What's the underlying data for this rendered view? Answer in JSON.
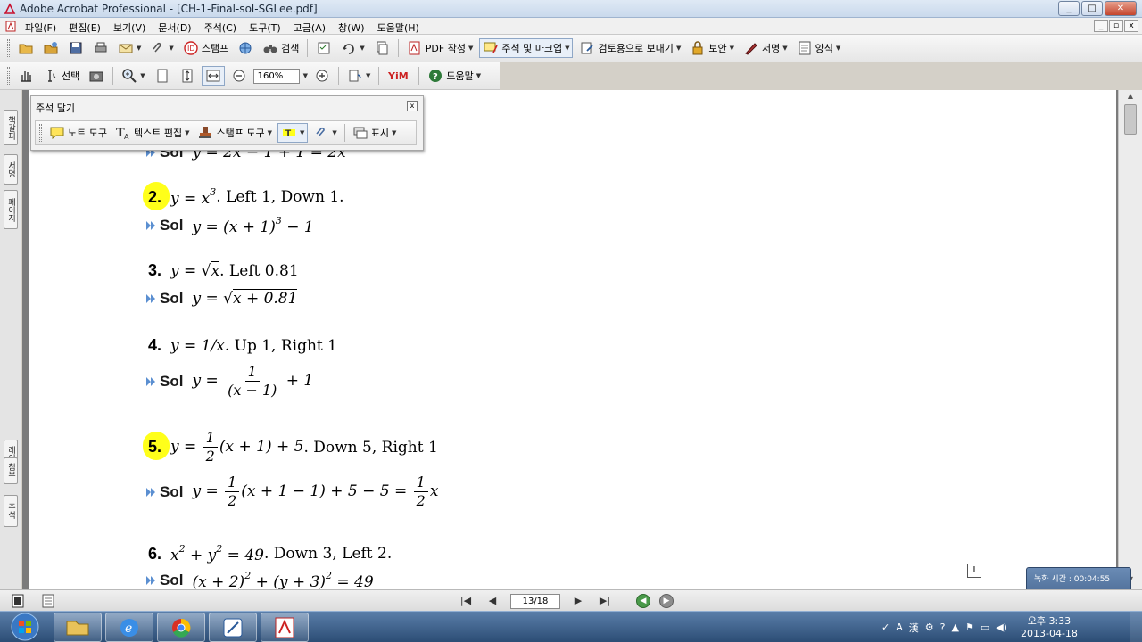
{
  "window": {
    "title": "Adobe Acrobat Professional - [CH-1-Final-sol-SGLee.pdf]",
    "buttons": [
      "_",
      "□",
      "✕"
    ]
  },
  "menu": {
    "items": [
      "파일(F)",
      "편집(E)",
      "보기(V)",
      "문서(D)",
      "주석(C)",
      "도구(T)",
      "고급(A)",
      "창(W)",
      "도움말(H)"
    ],
    "doc_buttons": [
      "_",
      "▫",
      "x"
    ]
  },
  "toolbar1": {
    "stamp": "스탬프",
    "search": "검색",
    "pdf_create": "PDF 작성",
    "comment_markup": "주석 및 마크업",
    "send_review": "검토용으로 보내기",
    "secure": "보안",
    "sign": "서명",
    "forms": "양식"
  },
  "toolbar2": {
    "select": "선택",
    "zoom": "160%",
    "help": "도움말"
  },
  "comment_toolbar": {
    "title": "주석 달기",
    "note_tool": "노트 도구",
    "text_edit": "텍스트 편집",
    "stamp_tool": "스탬프 도구",
    "show": "표시"
  },
  "left_nav": {
    "tabs_top": [
      "책갈피",
      "서명",
      "페이지"
    ],
    "tabs_bottom": [
      "레이어",
      "첨부",
      "주석"
    ]
  },
  "document": {
    "sol_label": "Sol",
    "problems": [
      {
        "num": "2.",
        "q_rest": ". Left 1, Down 1.",
        "highlight": true
      },
      {
        "num": "3.",
        "q_rest": ". Left 0.81",
        "highlight": false
      },
      {
        "num": "4.",
        "q_rest": ". Up 1, Right 1",
        "highlight": false
      },
      {
        "num": "5.",
        "q_rest": ". Down 5, Right 1",
        "highlight": true
      },
      {
        "num": "6.",
        "q_rest": ". Down 3, Left 2.",
        "highlight": false
      }
    ],
    "partial_sol": "y = 2x − 1 + 1 = 2x"
  },
  "page_nav": {
    "page": "13/18"
  },
  "timer": {
    "label": "녹화 시간 : 00:04:55"
  },
  "taskbar": {
    "time": "오후 3:33",
    "date": "2013-04-18"
  },
  "colors": {
    "highlight": "#ffff1a",
    "page_bg": "#ffffff",
    "chrome": "#d4d0c8"
  }
}
